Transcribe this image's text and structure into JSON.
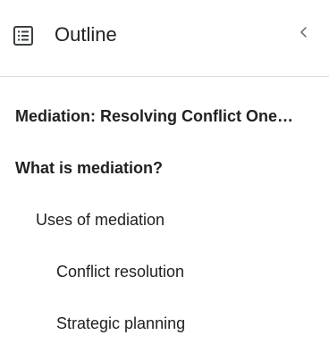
{
  "outline": {
    "icon": "outline-list-icon",
    "title": "Outline",
    "collapse_icon": "chevron-left-icon",
    "items": [
      {
        "label": "Mediation: Resolving Conflict One…",
        "level": 1
      },
      {
        "label": "What is mediation?",
        "level": 1
      },
      {
        "label": "Uses of mediation",
        "level": 2
      },
      {
        "label": "Conflict resolution",
        "level": 3
      },
      {
        "label": "Strategic planning",
        "level": 3
      }
    ]
  }
}
